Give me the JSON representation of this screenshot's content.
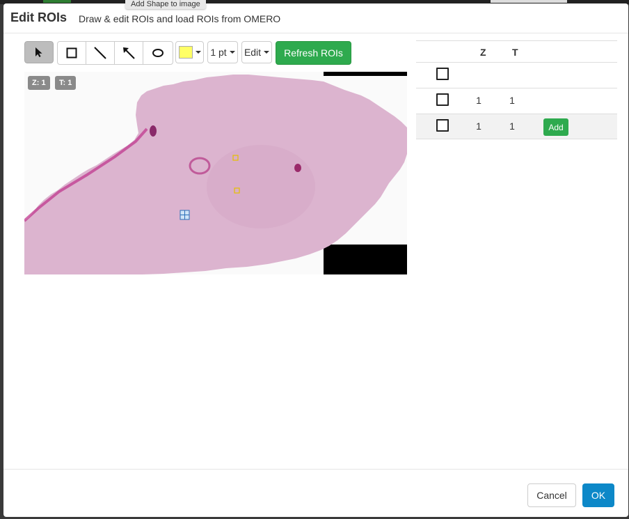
{
  "tooltip": "Add Shape to image",
  "dialog": {
    "title": "Edit ROIs",
    "subtitle": "Draw & edit ROIs and load ROIs from OMERO"
  },
  "toolbar": {
    "tools": [
      {
        "name": "select-tool",
        "icon": "pointer-icon",
        "active": true
      },
      {
        "name": "rectangle-tool",
        "icon": "rectangle-icon",
        "active": false
      },
      {
        "name": "line-tool",
        "icon": "line-icon",
        "active": false
      },
      {
        "name": "arrow-tool",
        "icon": "arrow-icon",
        "active": false
      },
      {
        "name": "ellipse-tool",
        "icon": "ellipse-icon",
        "active": false
      }
    ],
    "color": "#ffff66",
    "stroke_width": "1 pt",
    "edit_label": "Edit",
    "refresh_label": "Refresh ROIs"
  },
  "viewer": {
    "z_badge": "Z: 1",
    "t_badge": "T: 1"
  },
  "roi_table": {
    "headers": {
      "z": "Z",
      "t": "T"
    },
    "rows": [
      {
        "z": "",
        "t": "",
        "action": ""
      },
      {
        "z": "1",
        "t": "1",
        "action": ""
      },
      {
        "z": "1",
        "t": "1",
        "action": "Add"
      }
    ]
  },
  "footer": {
    "cancel_label": "Cancel",
    "ok_label": "OK"
  },
  "colors": {
    "green_button": "#2eaa4e",
    "primary_button": "#0d88c8",
    "tissue_pink": "#dcb4cf"
  }
}
